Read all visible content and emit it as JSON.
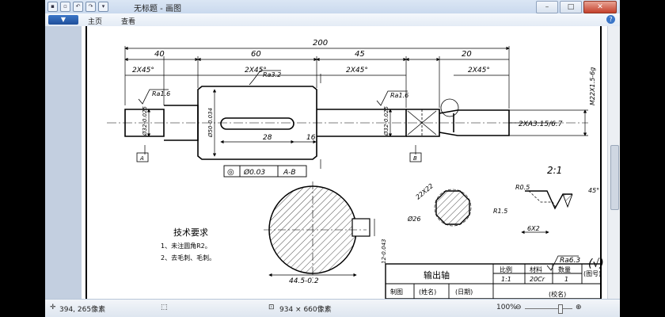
{
  "window": {
    "title": "无标题 - 画图",
    "ribbon_tabs": [
      "主页",
      "查看"
    ],
    "file_button": "▼",
    "controls": {
      "minimize": "–",
      "maximize": "□",
      "close": "✕"
    }
  },
  "drawing": {
    "dimensions": {
      "overall": "200",
      "d40": "40",
      "d60": "60",
      "d45": "45",
      "d20": "20",
      "chamfer1": "2X45°",
      "chamfer2": "2X45°",
      "chamfer3": "2X45°",
      "chamfer4": "2X45°",
      "keyway_len": "28",
      "keyway_off": "16",
      "dia1": "Ø32-0.025",
      "dia2": "Ø50-0.034",
      "dia3": "Ø32-0.025",
      "thread": "M22X1.5-6g",
      "groove": "2XA3.15/6.7",
      "section_dia": "44.5-0.2",
      "section_width": "12-0.043",
      "detail_angle": "22X22",
      "detail_dia": "Ø26"
    },
    "roughness": {
      "r1": "Ra1.6",
      "r2": "Ra3.2",
      "r3": "Ra1.6",
      "overall": "Ra6.3"
    },
    "datums": {
      "a": "A",
      "b": "B"
    },
    "tolerance_frame": {
      "symbol": "◎",
      "value": "Ø0.03",
      "ref": "A-B"
    },
    "detail": {
      "scale": "2:1",
      "r05": "R0.5",
      "r15": "R1.5",
      "angle": "45°",
      "size": "6X2"
    },
    "tech_req": {
      "title": "技术要求",
      "items": [
        "1、未注圆角R2。",
        "2、去毛刺、毛刺。"
      ]
    },
    "title_block": {
      "part_name": "输出轴",
      "h_scale": "比例",
      "h_material": "材料",
      "h_qty": "数量",
      "drawing_no": "(图号)",
      "scale": "1:1",
      "material": "20Cr",
      "qty": "1",
      "drawn_by": "制图",
      "name": "(姓名)",
      "date": "(日期)",
      "school": "(校名)"
    }
  },
  "statusbar": {
    "cursor": "394, 265像素",
    "canvas_size": "934 × 660像素",
    "zoom": "100%",
    "zoom_out": "⊖",
    "zoom_in": "⊕"
  }
}
